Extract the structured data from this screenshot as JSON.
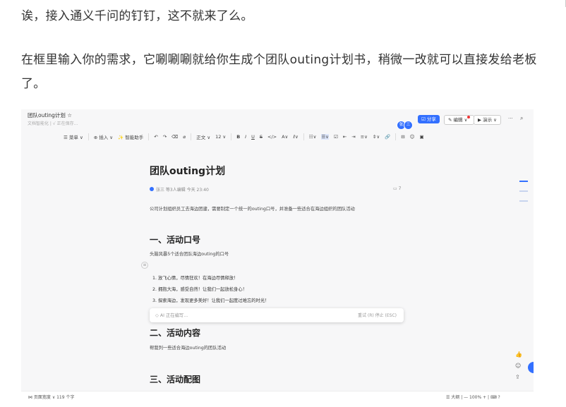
{
  "article": {
    "para1": "诶，接入通义千问的钉钉，这不就来了么。",
    "para2": "在框里输入你的需求，它唰唰唰就给你生成个团队outing计划书，稍微一改就可以直接发给老板了。"
  },
  "doc": {
    "title": "团队outing计划 ☆",
    "subtitle": "文档智能化 | √ 正在保存...",
    "avatars": [
      "张",
      "三"
    ],
    "share_label": "☑ 分享",
    "edit_label": "✎ 编辑 ∨",
    "present_label": "▶ 演示 ∨",
    "more_label": "···",
    "toolbar": [
      "☰ 菜单 ∨",
      "⊕ 插入 ∨",
      "✨ 智能助手",
      "↶",
      "↷",
      "⌫",
      "⌀",
      "正文 ∨",
      "12 ∨",
      "B",
      "I",
      "U",
      "S",
      "</>",
      "A∨",
      "ℓ∨",
      "☷∨",
      "☰∨",
      "☑",
      "⇤",
      "⇥",
      "≡∨",
      "⇕∨",
      "🔗",
      "⊟",
      "☺",
      "▣"
    ],
    "heading": "团队outing计划",
    "meta": "张三 等3人编辑 今天 23:40",
    "comment_count": "▭ 7",
    "intro": "公司计划组织员工去海边团建，需要制定一个统一的outing口号，并准备一些适合在海边组织的团队活动",
    "section1": {
      "title": "一、活动口号",
      "sub": "头脑风暴5个适合团队海边outing的口号",
      "items": [
        "1.  放飞心情，尽情狂欢！在海边尽情释放！",
        "2.  拥抱大海，感受自然！让我们一起放松身心！",
        "3.  探索海边，发现更多美好！让我们一起度过难忘的时光！"
      ]
    },
    "ai": {
      "status": "◇  AI 正在编写...",
      "actions": "重试 (R)   停止 (ESC)"
    },
    "section2": {
      "title": "二、活动内容",
      "sub": "帮我列一些适合海边outing的团队活动"
    },
    "section3": {
      "title": "三、活动配图"
    },
    "status_left": "⋈ 页面宽度 ∨   119 个字",
    "status_right": "☰ 大纲  |  —  100%  +  |  ⌨  ?"
  }
}
